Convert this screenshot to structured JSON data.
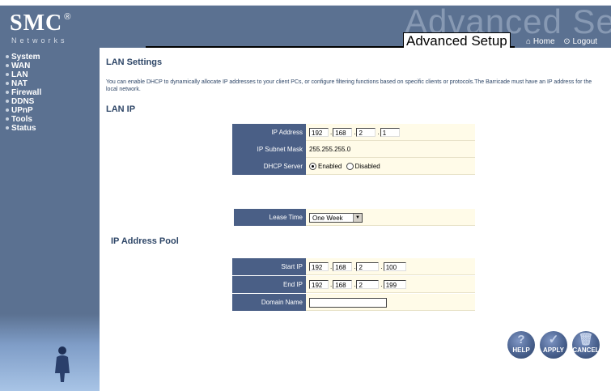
{
  "header": {
    "logo_main": "SMC",
    "logo_reg": "®",
    "logo_sub": "Networks",
    "watermark": "Advanced Setup",
    "page_title": "Advanced Setup",
    "home_icon": "home-icon",
    "home_label": "Home",
    "logout_icon": "logout-icon",
    "logout_label": "Logout"
  },
  "sidebar": {
    "items": [
      {
        "label": "System"
      },
      {
        "label": "WAN"
      },
      {
        "label": "LAN",
        "active": true
      },
      {
        "label": "NAT"
      },
      {
        "label": "Firewall"
      },
      {
        "label": "DDNS"
      },
      {
        "label": "UPnP"
      },
      {
        "label": "Tools"
      },
      {
        "label": "Status"
      }
    ]
  },
  "main": {
    "title": "LAN Settings",
    "description": "You can enable DHCP to dynamically allocate IP addresses to your client PCs, or configure filtering functions based on specific clients or protocols.The Barricade must have an IP address for the local network.",
    "lan_ip_heading": "LAN IP",
    "ip_label": "IP Address",
    "ip": [
      "192",
      "168",
      "2",
      "1"
    ],
    "subnet_label": "IP Subnet Mask",
    "subnet_value": "255.255.255.0",
    "dhcp_label": "DHCP Server",
    "dhcp_enabled_label": "Enabled",
    "dhcp_disabled_label": "Disabled",
    "dhcp_selected": "Enabled",
    "lease_label": "Lease Time",
    "lease_value": "One Week",
    "pool_heading": "IP Address Pool",
    "start_label": "Start IP",
    "start_ip": [
      "192",
      "168",
      "2",
      "100"
    ],
    "end_label": "End IP",
    "end_ip": [
      "192",
      "168",
      "2",
      "199"
    ],
    "domain_label": "Domain Name",
    "domain_value": ""
  },
  "buttons": {
    "help": "HELP",
    "apply": "APPLY",
    "cancel": "CANCEL"
  },
  "colors": {
    "nav_bg": "#5b7191",
    "label_bg": "#4a5f86",
    "value_bg": "#fffbe8",
    "heading": "#2e4667"
  }
}
